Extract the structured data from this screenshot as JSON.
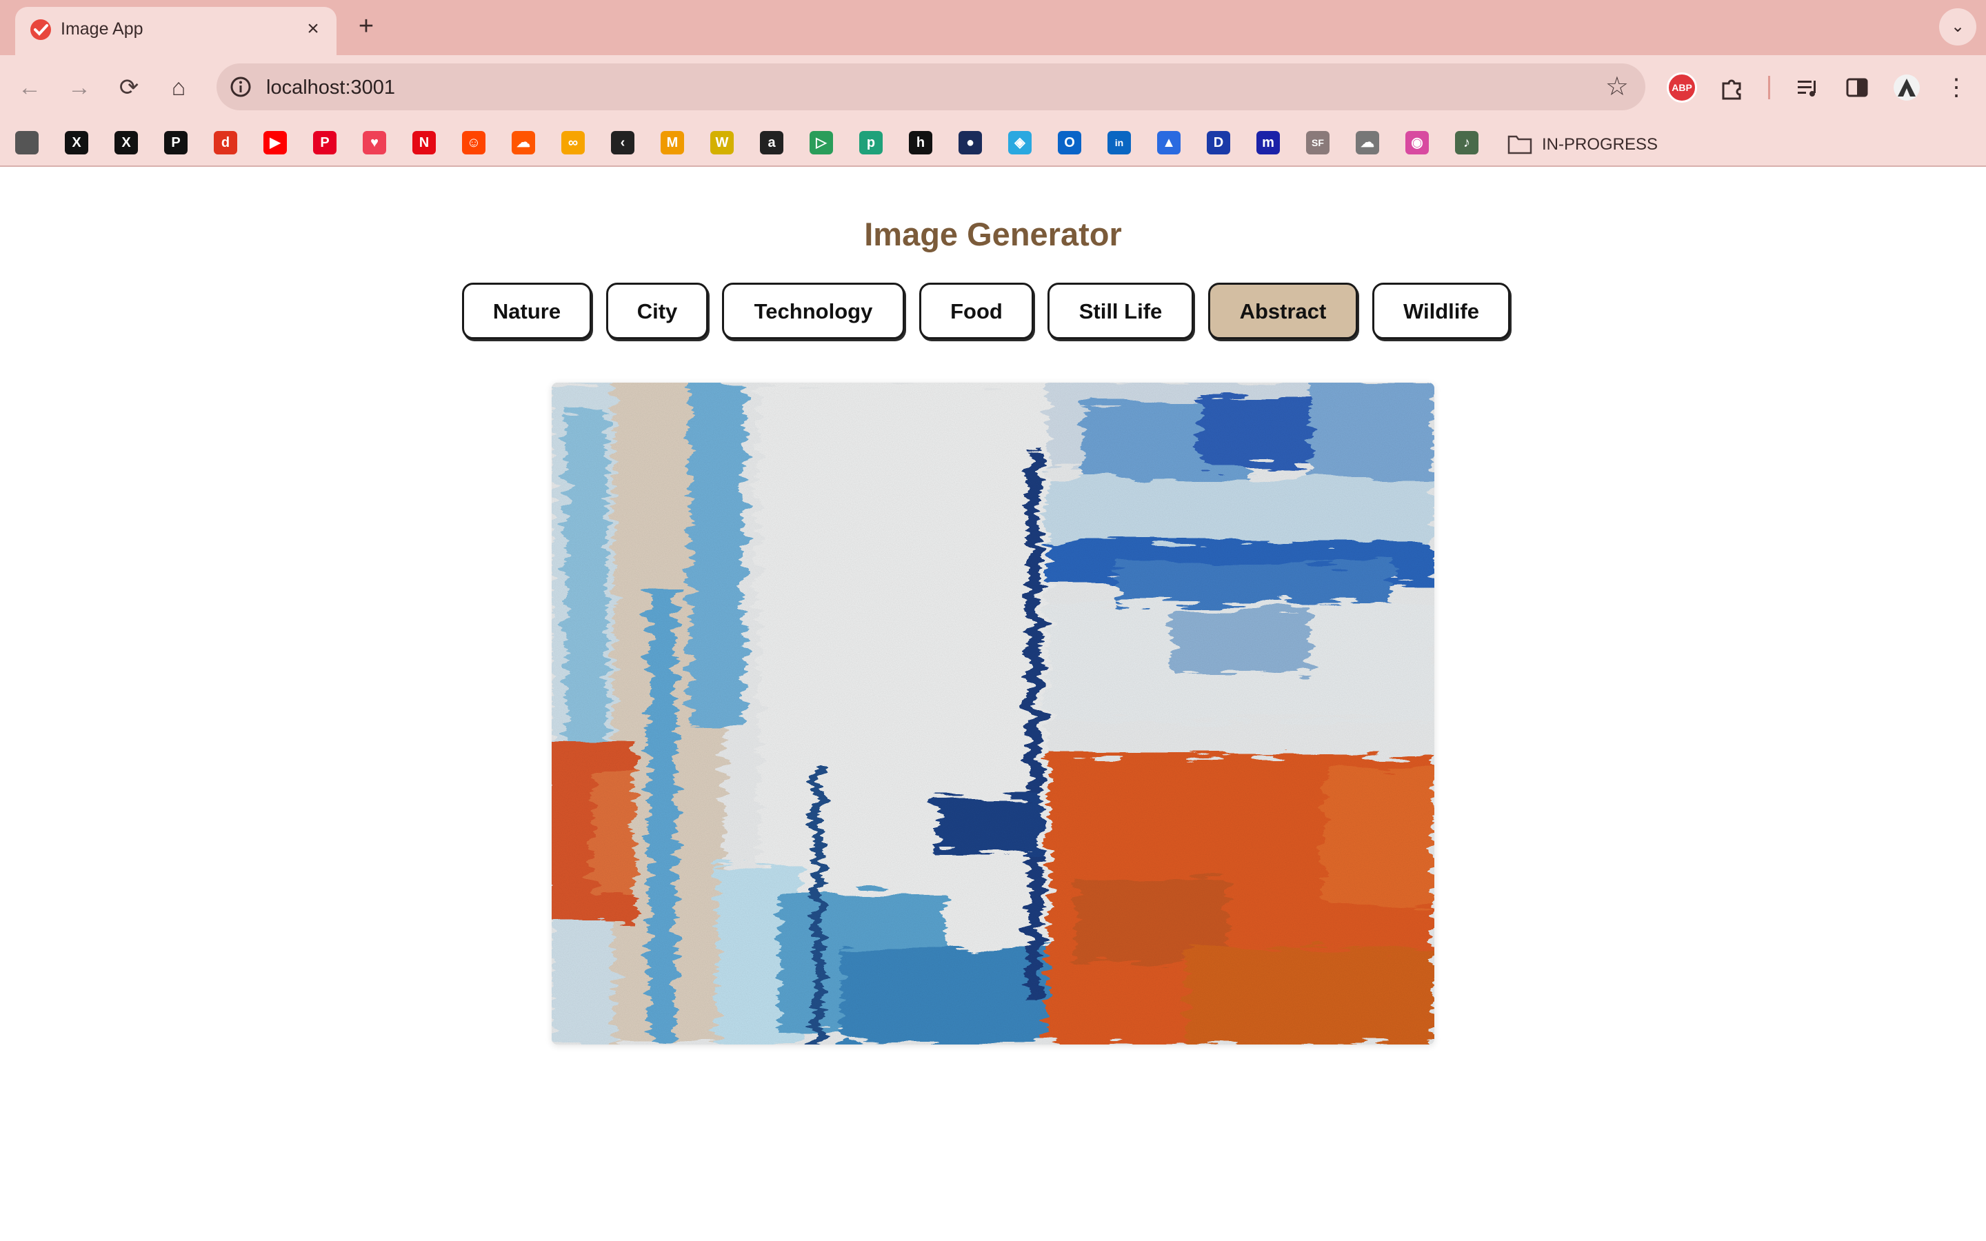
{
  "browser": {
    "tab": {
      "title": "Image App",
      "favicon": "red-check-icon",
      "close_label": "×"
    },
    "new_tab_label": "+",
    "tab_search_icon": "chevron-down-icon",
    "address": {
      "url": "localhost:3001",
      "info_icon": "info-icon",
      "star_icon": "star-icon"
    },
    "nav": {
      "back": "←",
      "forward": "→",
      "reload": "⟳",
      "home": "⌂"
    },
    "extensions": {
      "abp_label": "ABP"
    },
    "bookmarks": [
      {
        "icon": "cube-icon",
        "glyph": "",
        "color": "#555555"
      },
      {
        "icon": "x-icon",
        "glyph": "X",
        "color": "#111111"
      },
      {
        "icon": "x-icon",
        "glyph": "X",
        "color": "#111111"
      },
      {
        "icon": "p-icon",
        "glyph": "P",
        "color": "#111111"
      },
      {
        "icon": "d-icon",
        "glyph": "d",
        "color": "#e0321c"
      },
      {
        "icon": "youtube-icon",
        "glyph": "▶",
        "color": "#ff0000"
      },
      {
        "icon": "pinterest-icon",
        "glyph": "P",
        "color": "#e60023"
      },
      {
        "icon": "pocket-icon",
        "glyph": "♥",
        "color": "#ef4056"
      },
      {
        "icon": "netflix-icon",
        "glyph": "N",
        "color": "#e50914"
      },
      {
        "icon": "reddit-icon",
        "glyph": "☺",
        "color": "#ff4500"
      },
      {
        "icon": "soundcloud-icon",
        "glyph": "☁",
        "color": "#ff5500"
      },
      {
        "icon": "infinity-icon",
        "glyph": "∞",
        "color": "#f7a400"
      },
      {
        "icon": "leetcode-icon",
        "glyph": "‹",
        "color": "#222222"
      },
      {
        "icon": "m-icon",
        "glyph": "M",
        "color": "#f09a00"
      },
      {
        "icon": "w-icon",
        "glyph": "W",
        "color": "#d4b000"
      },
      {
        "icon": "amazon-icon",
        "glyph": "a",
        "color": "#222222"
      },
      {
        "icon": "play-icon",
        "glyph": "▷",
        "color": "#2a9d5a"
      },
      {
        "icon": "p-circle-icon",
        "glyph": "p",
        "color": "#1fa17a"
      },
      {
        "icon": "h-icon",
        "glyph": "h",
        "color": "#111111"
      },
      {
        "icon": "ninja-icon",
        "glyph": "●",
        "color": "#1a2b5a"
      },
      {
        "icon": "cube-blue-icon",
        "glyph": "◈",
        "color": "#2aa8e0"
      },
      {
        "icon": "outlook-icon",
        "glyph": "O",
        "color": "#0a64c8"
      },
      {
        "icon": "linkedin-icon",
        "glyph": "in",
        "color": "#0a66c2"
      },
      {
        "icon": "arc-icon",
        "glyph": "▲",
        "color": "#2a6ae0"
      },
      {
        "icon": "disney-icon",
        "glyph": "D",
        "color": "#1a3aa8"
      },
      {
        "icon": "m-square-icon",
        "glyph": "m",
        "color": "#1b22a8"
      },
      {
        "icon": "sfb-icon",
        "glyph": "SF",
        "color": "#8a7a7a"
      },
      {
        "icon": "cloud-icon",
        "glyph": "☁",
        "color": "#777777"
      },
      {
        "icon": "color-circle-icon",
        "glyph": "◉",
        "color": "#d84aa0"
      },
      {
        "icon": "bell-icon",
        "glyph": "♪",
        "color": "#4a6a4a"
      }
    ],
    "bookmark_folder": {
      "label": "IN-PROGRESS",
      "icon": "folder-icon"
    }
  },
  "page": {
    "title": "Image Generator",
    "categories": [
      {
        "label": "Nature",
        "active": false
      },
      {
        "label": "City",
        "active": false
      },
      {
        "label": "Technology",
        "active": false
      },
      {
        "label": "Food",
        "active": false
      },
      {
        "label": "Still Life",
        "active": false
      },
      {
        "label": "Abstract",
        "active": true
      },
      {
        "label": "Wildlife",
        "active": false
      }
    ],
    "active_color": "#d3bea2",
    "title_color": "#7b5b3a",
    "image": {
      "description_icon": "abstract-painting-image"
    }
  }
}
